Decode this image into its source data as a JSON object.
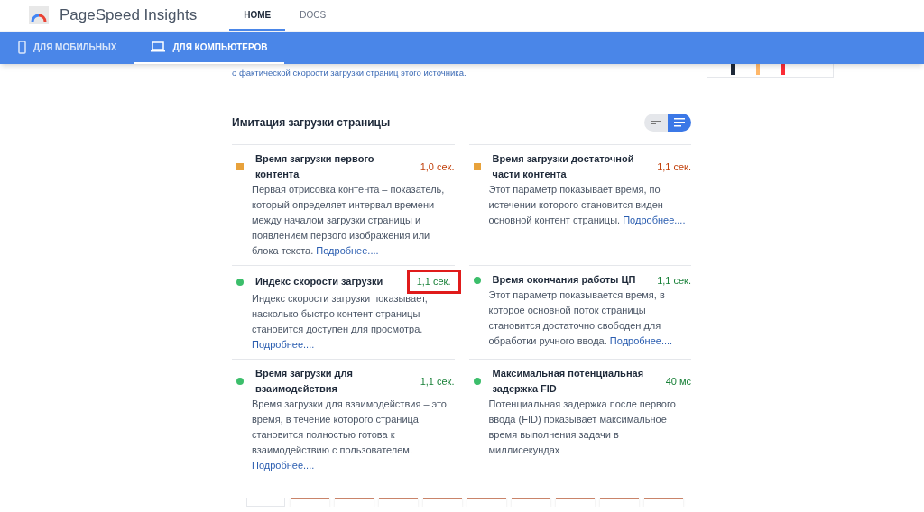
{
  "header": {
    "title": "PageSpeed Insights",
    "nav": [
      {
        "label": "HOME",
        "selected": true
      },
      {
        "label": "DOCS",
        "selected": false
      }
    ]
  },
  "device_tabs": [
    {
      "label": "ДЛЯ МОБИЛЬНЫХ",
      "kind": "phone",
      "selected": false
    },
    {
      "label": "ДЛЯ КОМПЬЮТЕРОВ",
      "kind": "desktop",
      "selected": true
    }
  ],
  "field_note": "о фактической скорости загрузки страниц этого источника.",
  "lab": {
    "title": "Имитация загрузки страницы",
    "view_toggle": [
      {
        "kind": "compact",
        "selected": false
      },
      {
        "kind": "expanded",
        "selected": true
      }
    ]
  },
  "metrics": [
    {
      "title": "Время загрузки первого контента",
      "value": "1,0 сек.",
      "kind": "square",
      "color": "#e8a23b",
      "highlighted": false,
      "description": "Первая отрисовка контента – показатель, который определяет интервал времени между началом загрузки страницы и появлением первого изображения или блока текста.",
      "link": "Подробнее...."
    },
    {
      "title": "Время загрузки достаточной части контента",
      "value": "1,1 сек.",
      "kind": "square",
      "color": "#e8a23b",
      "highlighted": false,
      "description": "Этот параметр показывает время, по истечении которого становится виден основной контент страницы.",
      "link": "Подробнее...."
    },
    {
      "title": "Индекс скорости загрузки",
      "value": "1,1 сек.",
      "kind": "circle",
      "color": "#3cbe6b",
      "highlighted": true,
      "description": "Индекс скорости загрузки показывает, насколько быстро контент страницы становится доступен для просмотра.",
      "link": "Подробнее...."
    },
    {
      "title": "Время окончания работы ЦП",
      "value": "1,1 сек.",
      "kind": "circle",
      "color": "#3cbe6b",
      "highlighted": false,
      "description": "Этот параметр показывается время, в которое основной поток страницы становится достаточно свободен для обработки ручного ввода.",
      "link": "Подробнее...."
    },
    {
      "title": "Время загрузки для взаимодействия",
      "value": "1,1 сек.",
      "kind": "circle",
      "color": "#3cbe6b",
      "highlighted": false,
      "description": "Время загрузки для взаимодействия – это время, в течение которого страница становится полностью готова к взаимодействию с пользователем.",
      "link": "Подробнее...."
    },
    {
      "title": "Максимальная потенциальная задержка FID",
      "value": "40 мс",
      "kind": "circle",
      "color": "#3cbe6b",
      "highlighted": false,
      "description": "Потенциальная задержка после первого ввода (FID) показывает максимальное время выполнения задачи в миллисекундах"
    }
  ]
}
